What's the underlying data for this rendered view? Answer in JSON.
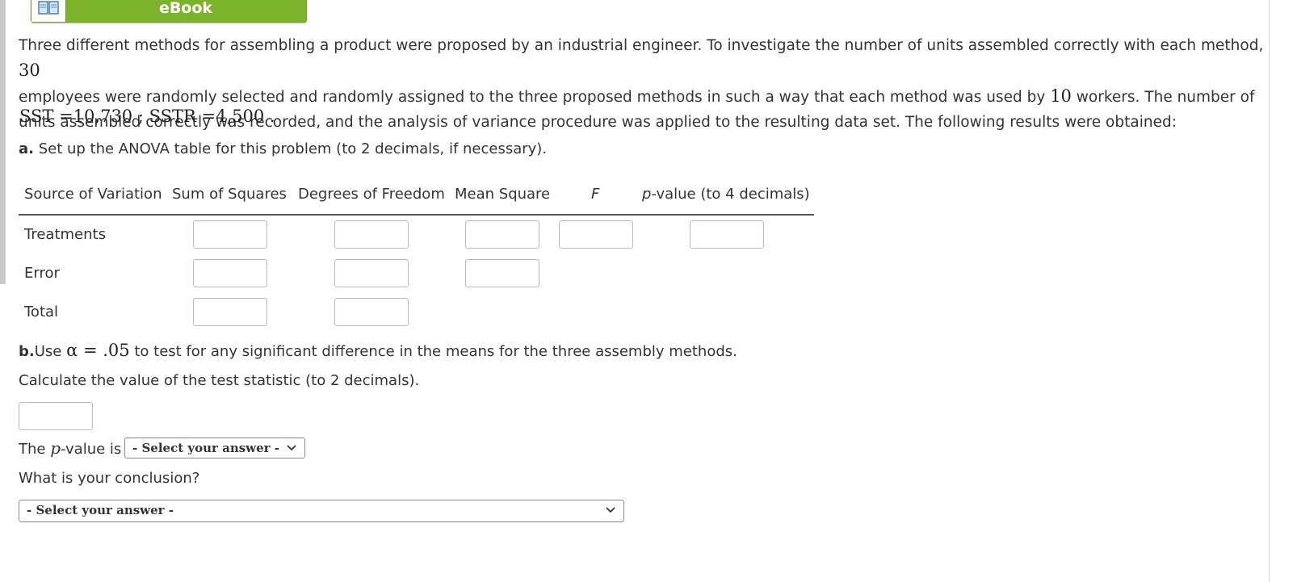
{
  "ebook": {
    "label": "eBook"
  },
  "problem": {
    "text_1": "Three different methods for assembling a product were proposed by an industrial engineer. To investigate the number of units assembled correctly with each method, ",
    "n_employees": "30",
    "text_2": "employees were randomly selected and randomly assigned to the three proposed methods in such a way that each method was used by ",
    "n_workers": "10",
    "text_3": " workers. The number of",
    "text_4": "units assembled correctly was recorded, and the analysis of variance procedure was applied to the resulting data set. The following results were obtained:",
    "given": "SST =10,730 ;  SSTR =4,500 ."
  },
  "part_a": {
    "prefix": "a.",
    "text": " Set up the ANOVA table for this problem (to 2 decimals, if necessary).",
    "columns": [
      "Source of Variation",
      "Sum of Squares",
      "Degrees of Freedom",
      "Mean Square",
      "F",
      "p-value (to 4 decimals)"
    ],
    "pvalue_italic": "p",
    "pvalue_rest": "-value (to 4 decimals)",
    "rows": [
      "Treatments",
      "Error",
      "Total"
    ]
  },
  "part_b": {
    "prefix": "b.",
    "text_pre": "Use ",
    "alpha": "α = .05",
    "text_post": " to test for any significant difference in the means for the three assembly methods.",
    "calc": "Calculate the value of the test statistic (to 2 decimals).",
    "pvalue_pre": "The ",
    "pvalue_p": "p",
    "pvalue_post": "-value is",
    "pvalue_select": "- Select your answer -",
    "conclusion_q": "What is your conclusion?",
    "conclusion_select": "- Select your answer -"
  },
  "colors": {
    "ebook_green": "#7db32a",
    "text": "#333333"
  },
  "icons": {
    "ebook": "book-icon",
    "select": "chevron-down-icon"
  }
}
